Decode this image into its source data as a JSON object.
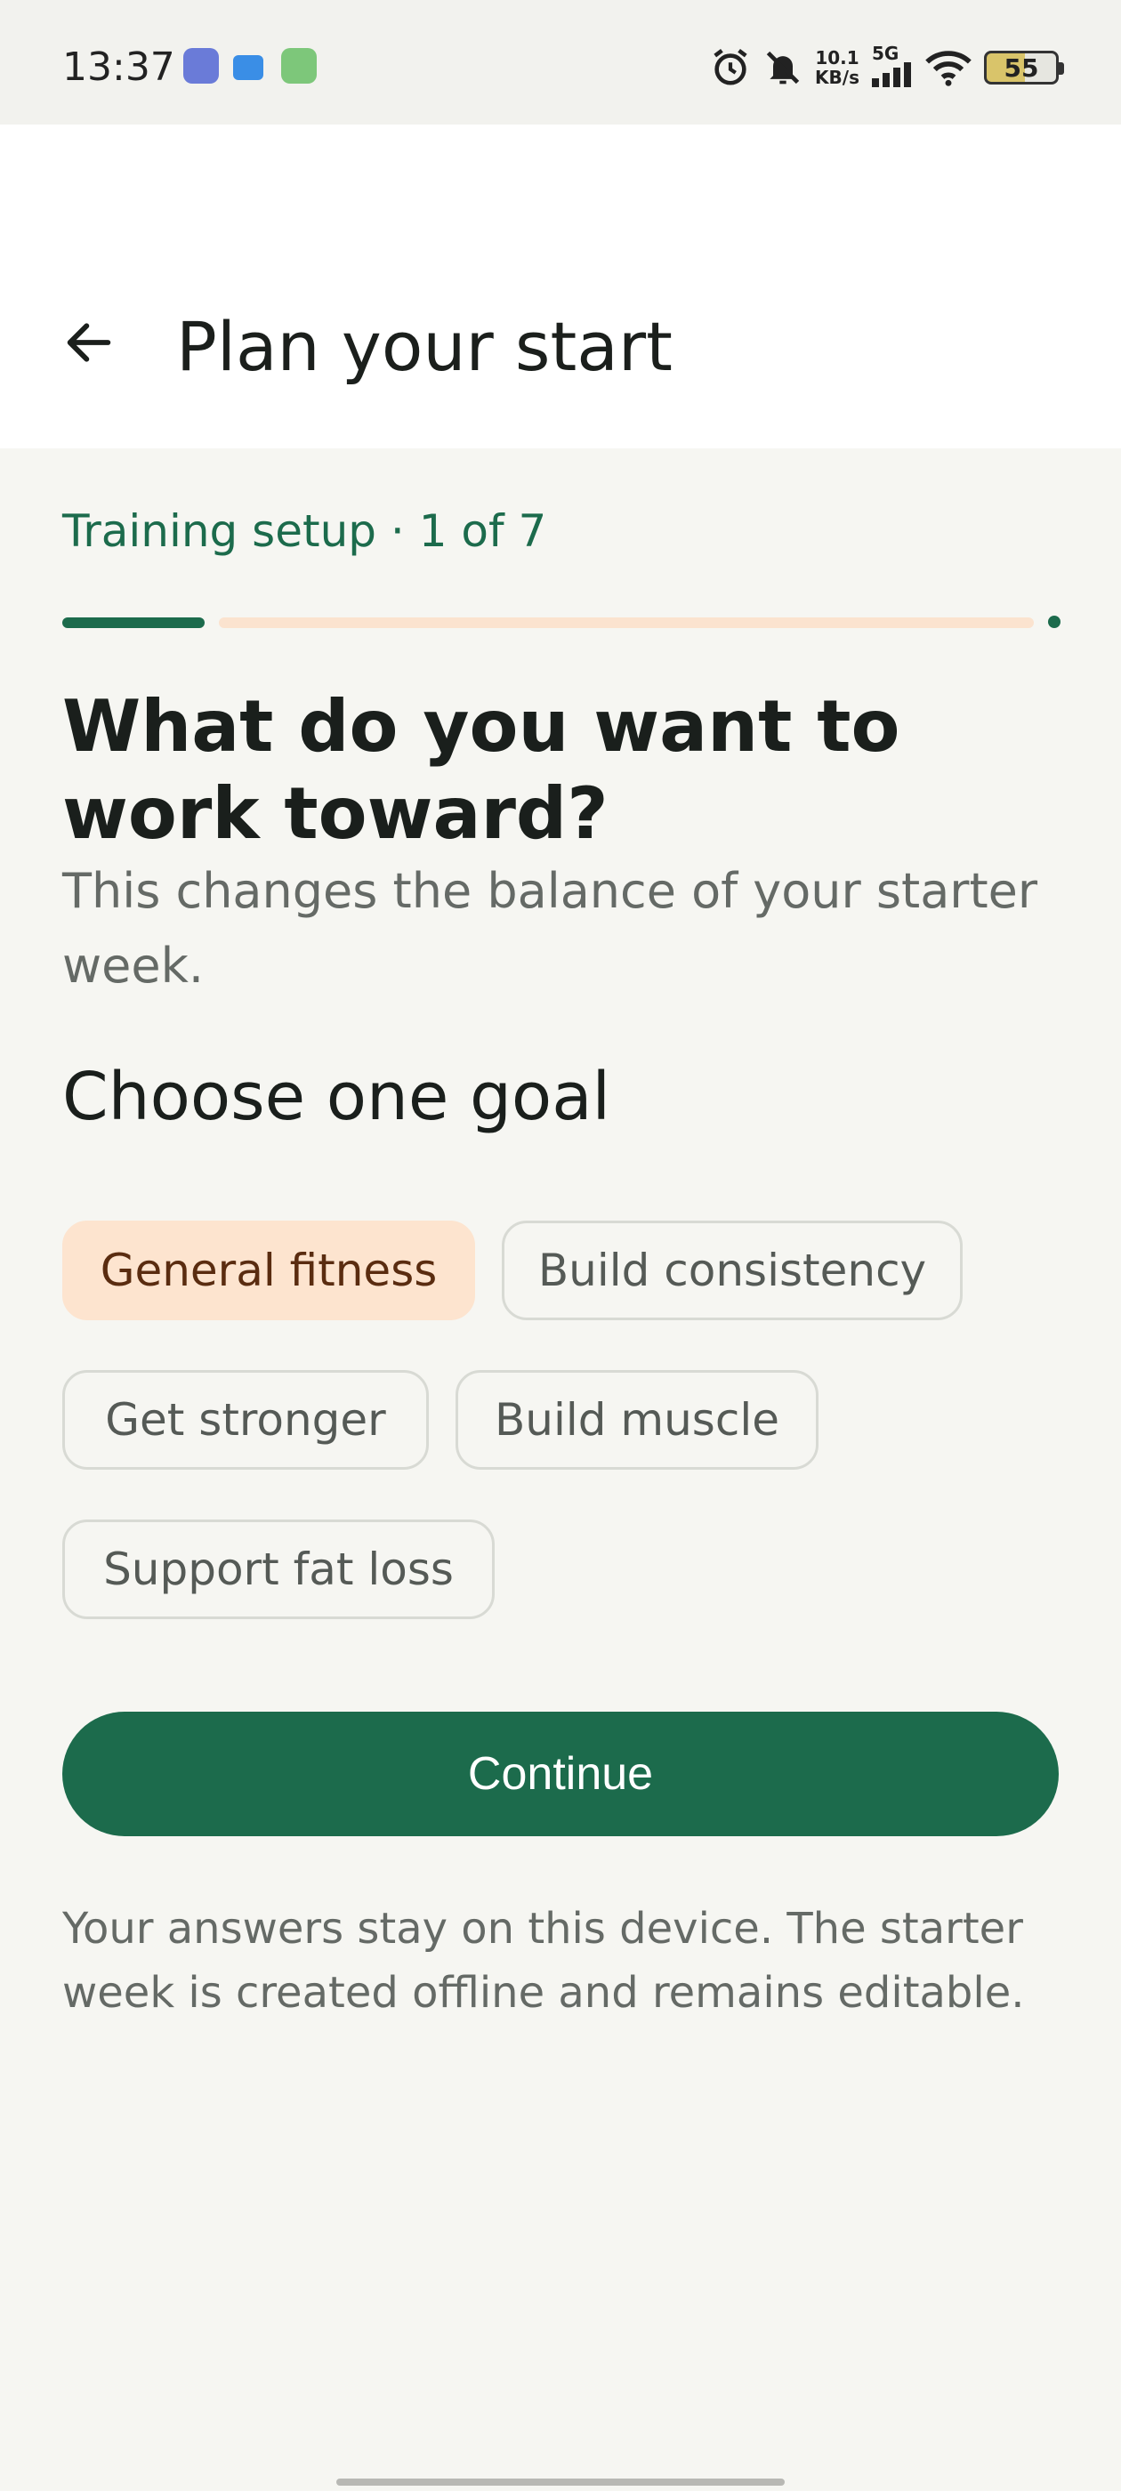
{
  "status_bar": {
    "time": "13:37",
    "network_speed_value": "10.1",
    "network_speed_unit": "KB/s",
    "network_type": "5G",
    "battery_level": "55",
    "icons": [
      "alarm-icon",
      "bell-off-icon",
      "signal-icon",
      "wifi-icon"
    ]
  },
  "app_bar": {
    "title": "Plan your start",
    "back_icon": "arrow-left-icon"
  },
  "progress": {
    "label": "Training setup · 1 of 7",
    "current_step": 1,
    "total_steps": 7
  },
  "question": {
    "title": "What do you want to work toward?",
    "subtitle": "This changes the balance of your starter week."
  },
  "goals": {
    "section_title": "Choose one goal",
    "options": [
      {
        "label": "General fitness",
        "selected": true
      },
      {
        "label": "Build consistency",
        "selected": false
      },
      {
        "label": "Get stronger",
        "selected": false
      },
      {
        "label": "Build muscle",
        "selected": false
      },
      {
        "label": "Support fat loss",
        "selected": false
      }
    ]
  },
  "actions": {
    "continue_label": "Continue"
  },
  "footnote": "Your answers stay on this device. The starter week is created offline and remains editable.",
  "colors": {
    "primary": "#1c6b4c",
    "selected_chip": "#fde4cf",
    "progress_rest": "#fbe3cf",
    "background": "#f6f6f2"
  }
}
